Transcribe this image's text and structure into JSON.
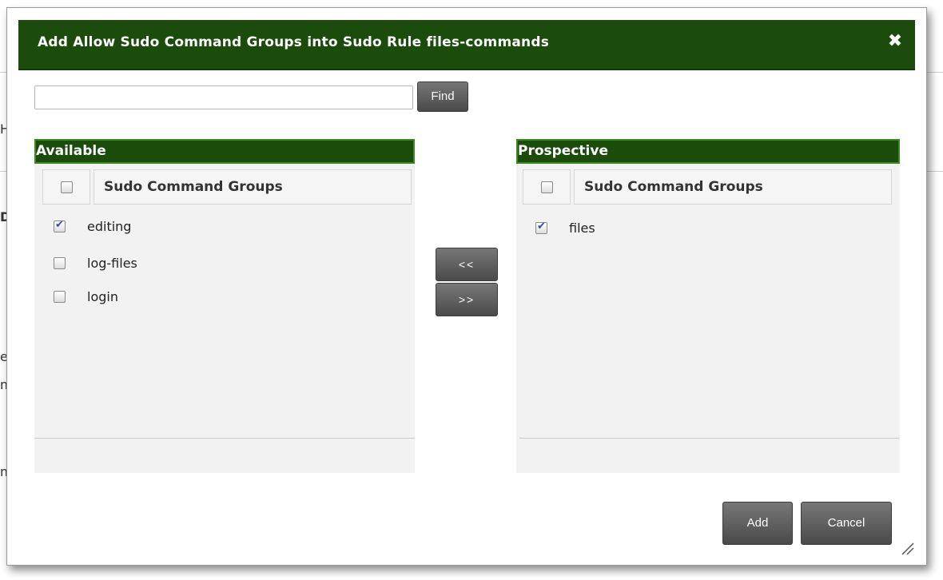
{
  "dialog": {
    "title": "Add Allow Sudo Command Groups into Sudo Rule files-commands",
    "close_glyph": "✖"
  },
  "search": {
    "value": "",
    "placeholder": "",
    "find_label": "Find"
  },
  "available": {
    "heading": "Available",
    "column_header": "Sudo Command Groups",
    "items": [
      {
        "label": "editing",
        "checked": true
      },
      {
        "label": "log-files",
        "checked": false
      },
      {
        "label": "login",
        "checked": false
      }
    ]
  },
  "prospective": {
    "heading": "Prospective",
    "column_header": "Sudo Command Groups",
    "items": [
      {
        "label": "files",
        "checked": true
      }
    ]
  },
  "move": {
    "left_label": "<<",
    "right_label": ">>"
  },
  "footer": {
    "add_label": "Add",
    "cancel_label": "Cancel"
  },
  "background_fragments": [
    "H",
    "D",
    "e",
    "m",
    "m"
  ],
  "colors": {
    "header_green": "#1b4c0b",
    "header_border": "#3c8a1f",
    "button_gray": "#5a5a5a"
  },
  "icons": {
    "close": "close-icon",
    "resize": "resize-grip-icon",
    "checkbox": "checkbox-icon"
  }
}
